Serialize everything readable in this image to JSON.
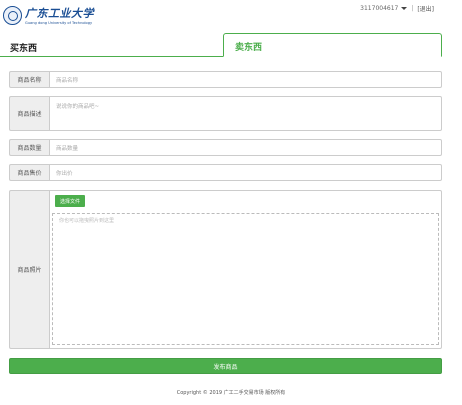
{
  "header": {
    "logo_cn": "广东工业大学",
    "logo_en": "Guang dong University of Technology",
    "username": "3117004617",
    "separator": "|",
    "logout": "[退出]"
  },
  "tabs": {
    "buy": "买东西",
    "sell": "卖东西"
  },
  "form": {
    "name_label": "商品名称",
    "name_placeholder": "商品名称",
    "desc_label": "商品描述",
    "desc_placeholder": "说说你的商品吧~",
    "qty_label": "商品数量",
    "qty_placeholder": "商品数量",
    "price_label": "商品售价",
    "price_placeholder": "你出价",
    "photo_label": "商品照片",
    "choose_file": "选择文件",
    "drop_hint": "你也可以拖曳照片到这里"
  },
  "submit_label": "发布商品",
  "footer": "Copyright © 2019 广工二手交易市场 版权所有",
  "colors": {
    "accent": "#4cae4c",
    "brand_blue": "#1a4e94"
  }
}
